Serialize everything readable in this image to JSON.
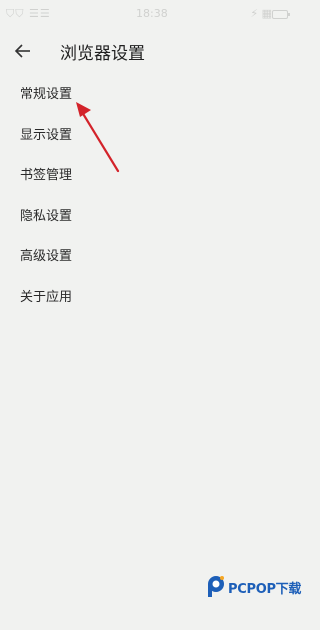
{
  "status_bar": {
    "left_text": "⛉⛉ ☰☰",
    "time": "18:38",
    "right_text": "⚡ ▦"
  },
  "header": {
    "title": "浏览器设置",
    "back_icon": "arrow-left-icon"
  },
  "menu": {
    "items": [
      {
        "label": "常规设置"
      },
      {
        "label": "显示设置"
      },
      {
        "label": "书签管理"
      },
      {
        "label": "隐私设置"
      },
      {
        "label": "高级设置"
      },
      {
        "label": "关于应用"
      }
    ]
  },
  "annotation": {
    "arrow_color": "#d3232a"
  },
  "watermark": {
    "text": "PCPOP下载",
    "color": "#1d5fb8"
  }
}
